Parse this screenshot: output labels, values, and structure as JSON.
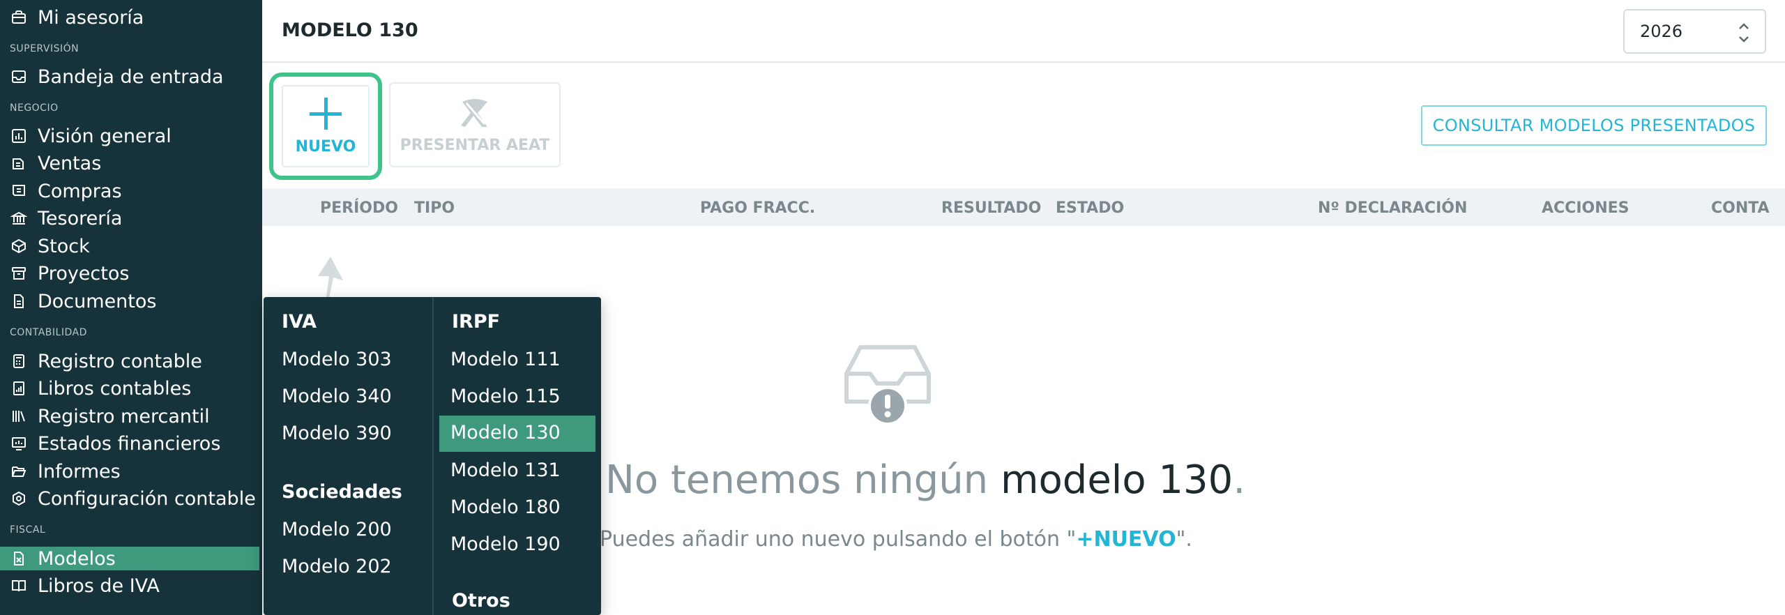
{
  "sidebar": {
    "sections": {
      "supervision": "SUPERVISIÓN",
      "negocio": "NEGOCIO",
      "contabilidad": "CONTABILIDAD",
      "fiscal": "FISCAL"
    },
    "items": {
      "mi_asesoria": "Mi asesoría",
      "bandeja": "Bandeja de entrada",
      "vision": "Visión general",
      "ventas": "Ventas",
      "compras": "Compras",
      "tesoreria": "Tesorería",
      "stock": "Stock",
      "proyectos": "Proyectos",
      "documentos": "Documentos",
      "registro_contable": "Registro contable",
      "libros_contables": "Libros contables",
      "registro_mercantil": "Registro mercantil",
      "estados_financieros": "Estados financieros",
      "informes": "Informes",
      "configuracion_contable": "Configuración contable",
      "modelos": "Modelos",
      "libros_iva": "Libros de IVA"
    },
    "active": "modelos"
  },
  "header": {
    "title": "MODELO 130",
    "year": "2026"
  },
  "toolbar": {
    "nuevo": "NUEVO",
    "presentar": "PRESENTAR AEAT",
    "consultar": "CONSULTAR MODELOS PRESENTADOS"
  },
  "table": {
    "columns": {
      "periodo": "PERÍODO",
      "tipo": "TIPO",
      "pago": "PAGO FRACC.",
      "resultado": "RESULTADO",
      "estado": "ESTADO",
      "declaracion": "Nº DECLARACIÓN",
      "acciones": "ACCIONES",
      "conta": "CONTA"
    }
  },
  "empty_state": {
    "title_prefix": "No tenemos ningún",
    "title_highlight": "modelo 130",
    "title_suffix": ".",
    "subtitle_prefix": "Puedes añadir uno nuevo pulsando el botón \"",
    "subtitle_link": "+NUEVO",
    "subtitle_suffix": "\"."
  },
  "dropdown": {
    "iva": {
      "heading": "IVA",
      "items": [
        "Modelo 303",
        "Modelo 340",
        "Modelo 390"
      ]
    },
    "sociedades": {
      "heading": "Sociedades",
      "items": [
        "Modelo 200",
        "Modelo 202"
      ]
    },
    "irpf": {
      "heading": "IRPF",
      "items": [
        "Modelo 111",
        "Modelo 115",
        "Modelo 130",
        "Modelo 131",
        "Modelo 180",
        "Modelo 190"
      ]
    },
    "otros": {
      "heading": "Otros"
    },
    "selected": "Modelo 130"
  },
  "colors": {
    "sidebar_bg": "#16323a",
    "active_green": "#3f9a7d",
    "accent_cyan": "#22b5d6",
    "highlight_border": "#3fc38b"
  },
  "icons": {
    "nuevo": "plus-icon",
    "presentar": "aeat-logo-icon",
    "empty": "empty-inbox-alert-icon",
    "year": "chevron-updown-icon"
  }
}
